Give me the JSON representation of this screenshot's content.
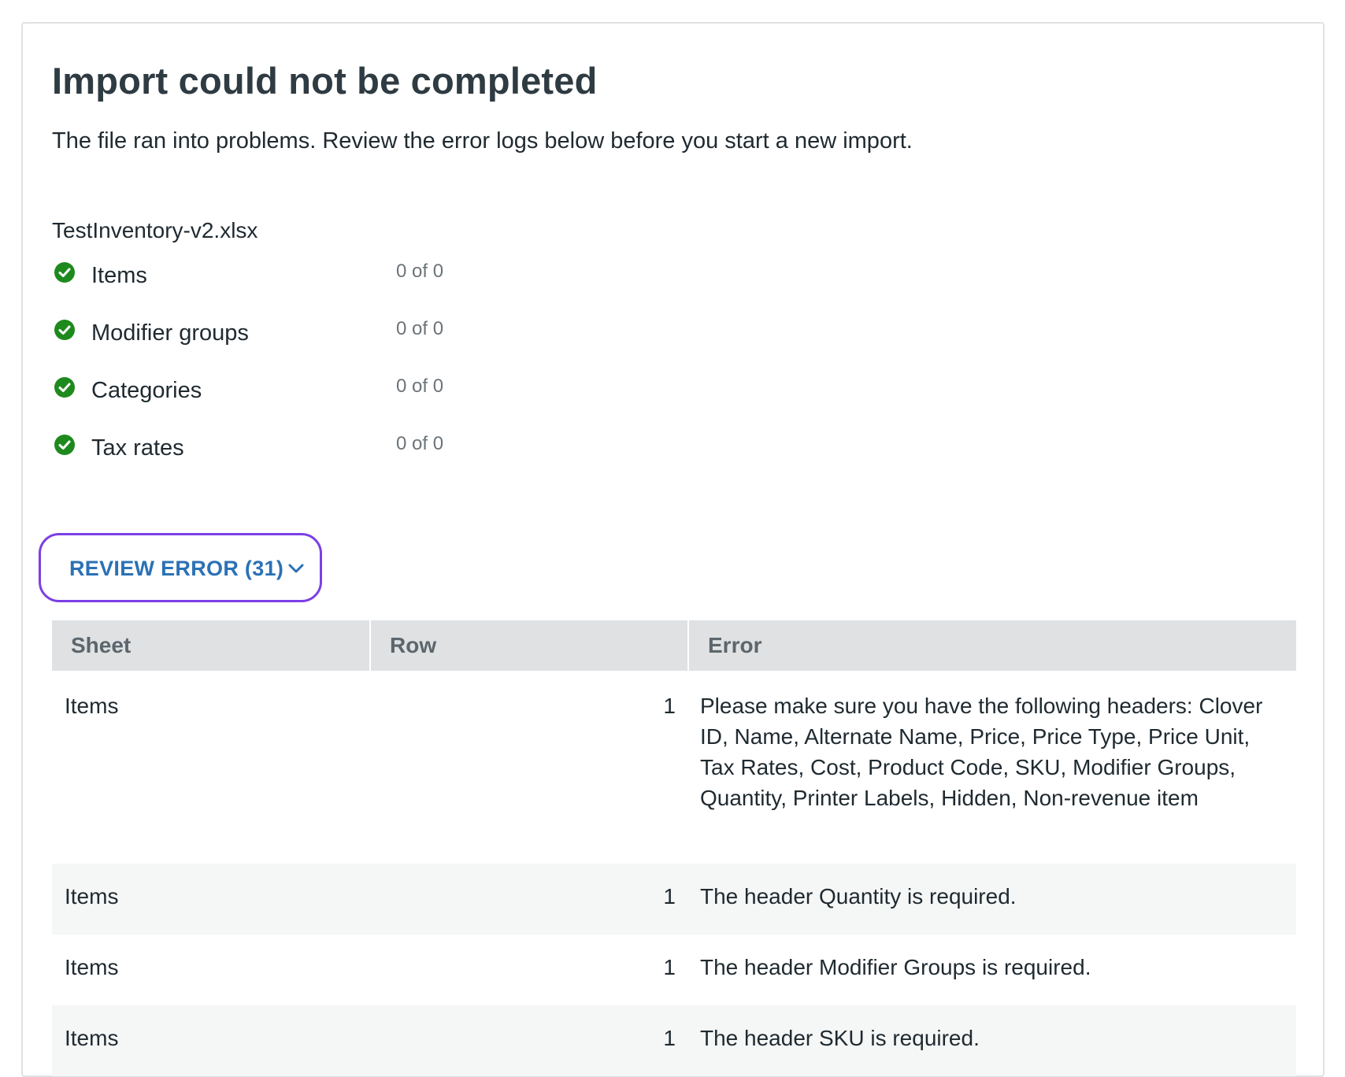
{
  "header": {
    "title": "Import could not be completed",
    "subtitle": "The file ran into problems. Review the error logs below before you start a new import."
  },
  "file": {
    "name": "TestInventory-v2.xlsx"
  },
  "stats": [
    {
      "label": "Items",
      "count": "0 of 0",
      "icon": "check-circle-icon"
    },
    {
      "label": "Modifier groups",
      "count": "0 of 0",
      "icon": "check-circle-icon"
    },
    {
      "label": "Categories",
      "count": "0 of 0",
      "icon": "check-circle-icon"
    },
    {
      "label": "Tax rates",
      "count": "0 of 0",
      "icon": "check-circle-icon"
    }
  ],
  "review_button": {
    "label": "REVIEW ERROR (31)",
    "icon": "chevron-down-icon"
  },
  "table": {
    "headers": [
      "Sheet",
      "Row",
      "Error"
    ],
    "rows": [
      {
        "sheet": "Items",
        "row": "1",
        "error": "Please make sure you have the following headers: Clover ID, Name, Alternate Name, Price, Price Type, Price Unit, Tax Rates, Cost, Product Code, SKU, Modifier Groups, Quantity, Printer Labels, Hidden, Non-revenue item"
      },
      {
        "sheet": "Items",
        "row": "1",
        "error": "The header Quantity is required."
      },
      {
        "sheet": "Items",
        "row": "1",
        "error": "The header Modifier Groups is required."
      },
      {
        "sheet": "Items",
        "row": "1",
        "error": "The header SKU is required."
      }
    ]
  },
  "colors": {
    "success": "#1e8a1e",
    "focus_ring": "#7b3fe4",
    "link": "#2b71b5",
    "header_bg": "#dfe1e3"
  }
}
